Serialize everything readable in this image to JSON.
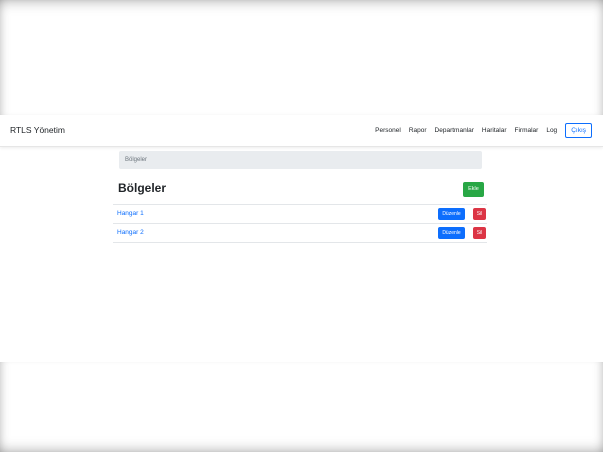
{
  "navbar": {
    "brand": "RTLS Yönetim",
    "links": [
      "Personel",
      "Rapor",
      "Departmanlar",
      "Haritalar",
      "Firmalar",
      "Log"
    ],
    "logout": "Çıkış"
  },
  "breadcrumb": {
    "current": "Bölgeler"
  },
  "page": {
    "title": "Bölgeler",
    "add_label": "Ekle"
  },
  "regions": [
    {
      "name": "Hangar 1",
      "edit_label": "Düzenle",
      "delete_label": "Sil"
    },
    {
      "name": "Hangar 2",
      "edit_label": "Düzenle",
      "delete_label": "Sil"
    }
  ],
  "colors": {
    "primary": "#0d6efd",
    "success": "#28a745",
    "danger": "#dc3545",
    "breadcrumb_bg": "#e9ecef"
  }
}
